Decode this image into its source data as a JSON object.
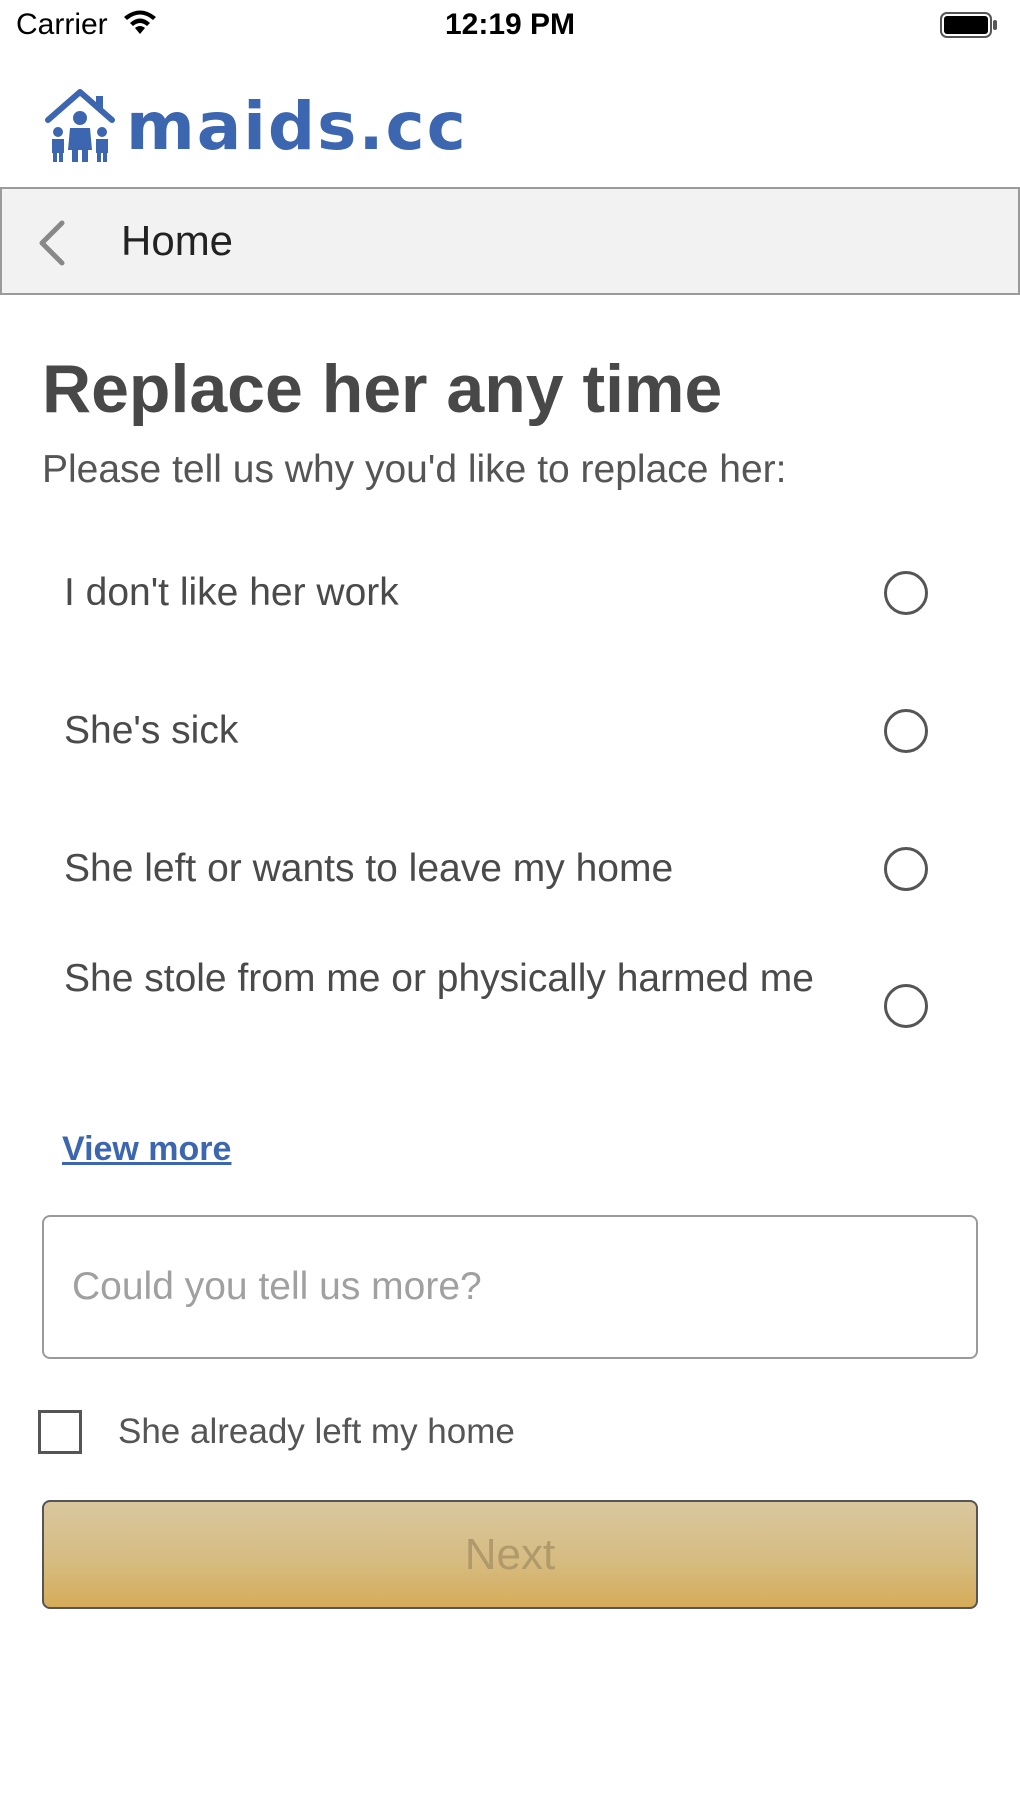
{
  "status_bar": {
    "carrier": "Carrier",
    "time": "12:19 PM",
    "wifi_icon": "wifi-icon",
    "battery_icon": "battery-full-icon"
  },
  "logo": {
    "text": "maids.cc",
    "icon": "house-family-icon",
    "color": "#3c66b0"
  },
  "nav": {
    "back_icon": "chevron-left-icon",
    "title": "Home"
  },
  "main": {
    "title": "Replace her any time",
    "subtitle": "Please tell us why you'd like to replace her:",
    "options": [
      {
        "label": "I don't like her work",
        "selected": false
      },
      {
        "label": "She's sick",
        "selected": false
      },
      {
        "label": "She left or wants to leave my home",
        "selected": false
      },
      {
        "label": "She stole from me or physically harmed me",
        "selected": false
      }
    ],
    "view_more": "View more",
    "more_input": {
      "placeholder": "Could you tell us more?",
      "value": ""
    },
    "already_left": {
      "label": "She already left my home",
      "checked": false
    },
    "next_label": "Next"
  },
  "colors": {
    "accent": "#3c66b0",
    "button_gold": "#d6ac5a",
    "nav_background": "#f2f2f2"
  }
}
